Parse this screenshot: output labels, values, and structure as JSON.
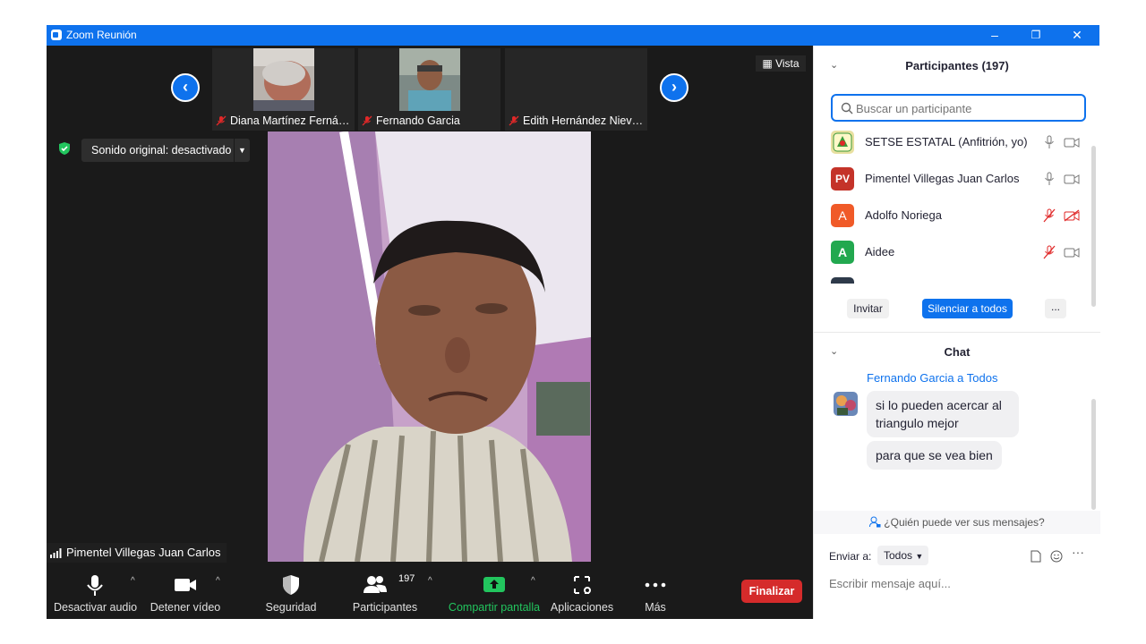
{
  "window": {
    "title": "Zoom Reunión",
    "minimize": "–",
    "restore": "❐",
    "close": "✕"
  },
  "stage": {
    "vista_label": "Vista",
    "sound_label": "Sonido original: desactivado",
    "thumbnails": [
      {
        "name": "Diana Martínez Ferná…"
      },
      {
        "name": "Fernando Garcia"
      },
      {
        "name": "Edith Hernández Niev…"
      }
    ],
    "speaker_name": "Pimentel Villegas Juan Carlos"
  },
  "toolbar": {
    "audio": "Desactivar audio",
    "video": "Detener vídeo",
    "security": "Seguridad",
    "participants": "Participantes",
    "participants_count": "197",
    "share": "Compartir pantalla",
    "apps": "Aplicaciones",
    "more": "Más",
    "end": "Finalizar"
  },
  "participants_panel": {
    "title": "Participantes (197)",
    "search_placeholder": "Buscar un participante",
    "list": [
      {
        "name": "SETSE ESTATAL (Anfitrión, yo)",
        "avatar": "",
        "avatar_color": "#e8e0a0",
        "muted": false,
        "video_off": false
      },
      {
        "name": "Pimentel Villegas Juan Carlos",
        "avatar": "PV",
        "avatar_color": "#c43329",
        "muted": false,
        "video_off": false
      },
      {
        "name": "Adolfo Noriega",
        "avatar": "A",
        "avatar_color": "#f05a28",
        "muted": true,
        "video_off": true
      },
      {
        "name": "Aidee",
        "avatar": "A",
        "avatar_color": "#22a84f",
        "muted": true,
        "video_off": false
      }
    ],
    "invite": "Invitar",
    "mute_all": "Silenciar a todos",
    "more": "..."
  },
  "chat_panel": {
    "title": "Chat",
    "sender": "Fernando Garcia a Todos",
    "messages": [
      "si lo pueden acercar al triangulo mejor",
      "para que se vea bien"
    ],
    "who_sees": "¿Quién puede ver sus mensajes?",
    "send_to_label": "Enviar a:",
    "send_to_value": "Todos",
    "input_placeholder": "Escribir mensaje aquí...",
    "more": "···"
  },
  "colors": {
    "zoom_blue": "#0e72ed",
    "end_red": "#d52b2b",
    "share_green": "#22c55e",
    "mute_red": "#e02828"
  }
}
